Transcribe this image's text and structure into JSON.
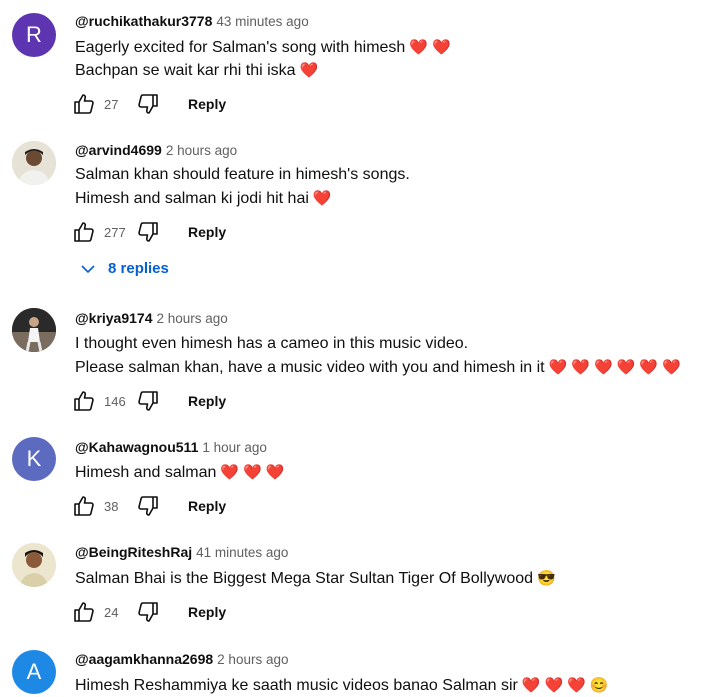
{
  "comments": [
    {
      "handle": "@ruchikathakur3778",
      "time": "43 minutes ago",
      "avatar_letter": "R",
      "avatar_color": "#5e35b1",
      "lines": [
        "Eagerly excited for Salman's song with himesh",
        "Bachpan se wait kar rhi thi iska"
      ],
      "likes": "27",
      "reply_label": "Reply"
    },
    {
      "handle": "@arvind4699",
      "time": "2 hours ago",
      "lines": [
        "Salman khan should feature in himesh's songs.",
        "Himesh and salman ki jodi hit hai"
      ],
      "likes": "277",
      "reply_label": "Reply",
      "replies_label": "8 replies"
    },
    {
      "handle": "@kriya9174",
      "time": "2 hours ago",
      "lines": [
        "I thought even himesh has a cameo in this music video.",
        "Please salman khan, have a music video with you and himesh in it"
      ],
      "likes": "146",
      "reply_label": "Reply"
    },
    {
      "handle": "@Kahawagnou511",
      "time": "1 hour ago",
      "avatar_letter": "K",
      "avatar_color": "#5c6bc0",
      "lines": [
        "Himesh and salman"
      ],
      "likes": "38",
      "reply_label": "Reply"
    },
    {
      "handle": "@BeingRiteshRaj",
      "time": "41 minutes ago",
      "lines": [
        "Salman Bhai is the Biggest Mega Star Sultan Tiger Of Bollywood"
      ],
      "likes": "24",
      "reply_label": "Reply"
    },
    {
      "handle": "@aagamkhanna2698",
      "time": "2 hours ago",
      "avatar_letter": "A",
      "avatar_color": "#1e88e5",
      "lines": [
        "Himesh Reshammiya ke saath music videos banao Salman sir"
      ]
    }
  ],
  "icons": {
    "like": "thumbs-up-icon",
    "dislike": "thumbs-down-icon",
    "heart": "heart-emoji",
    "sunglasses": "sunglasses-emoji",
    "smile": "smiling-emoji",
    "expand": "chevron-down-icon"
  },
  "colors": {
    "heart": "#e3342f",
    "link": "#065fd4",
    "meta": "#606060"
  }
}
